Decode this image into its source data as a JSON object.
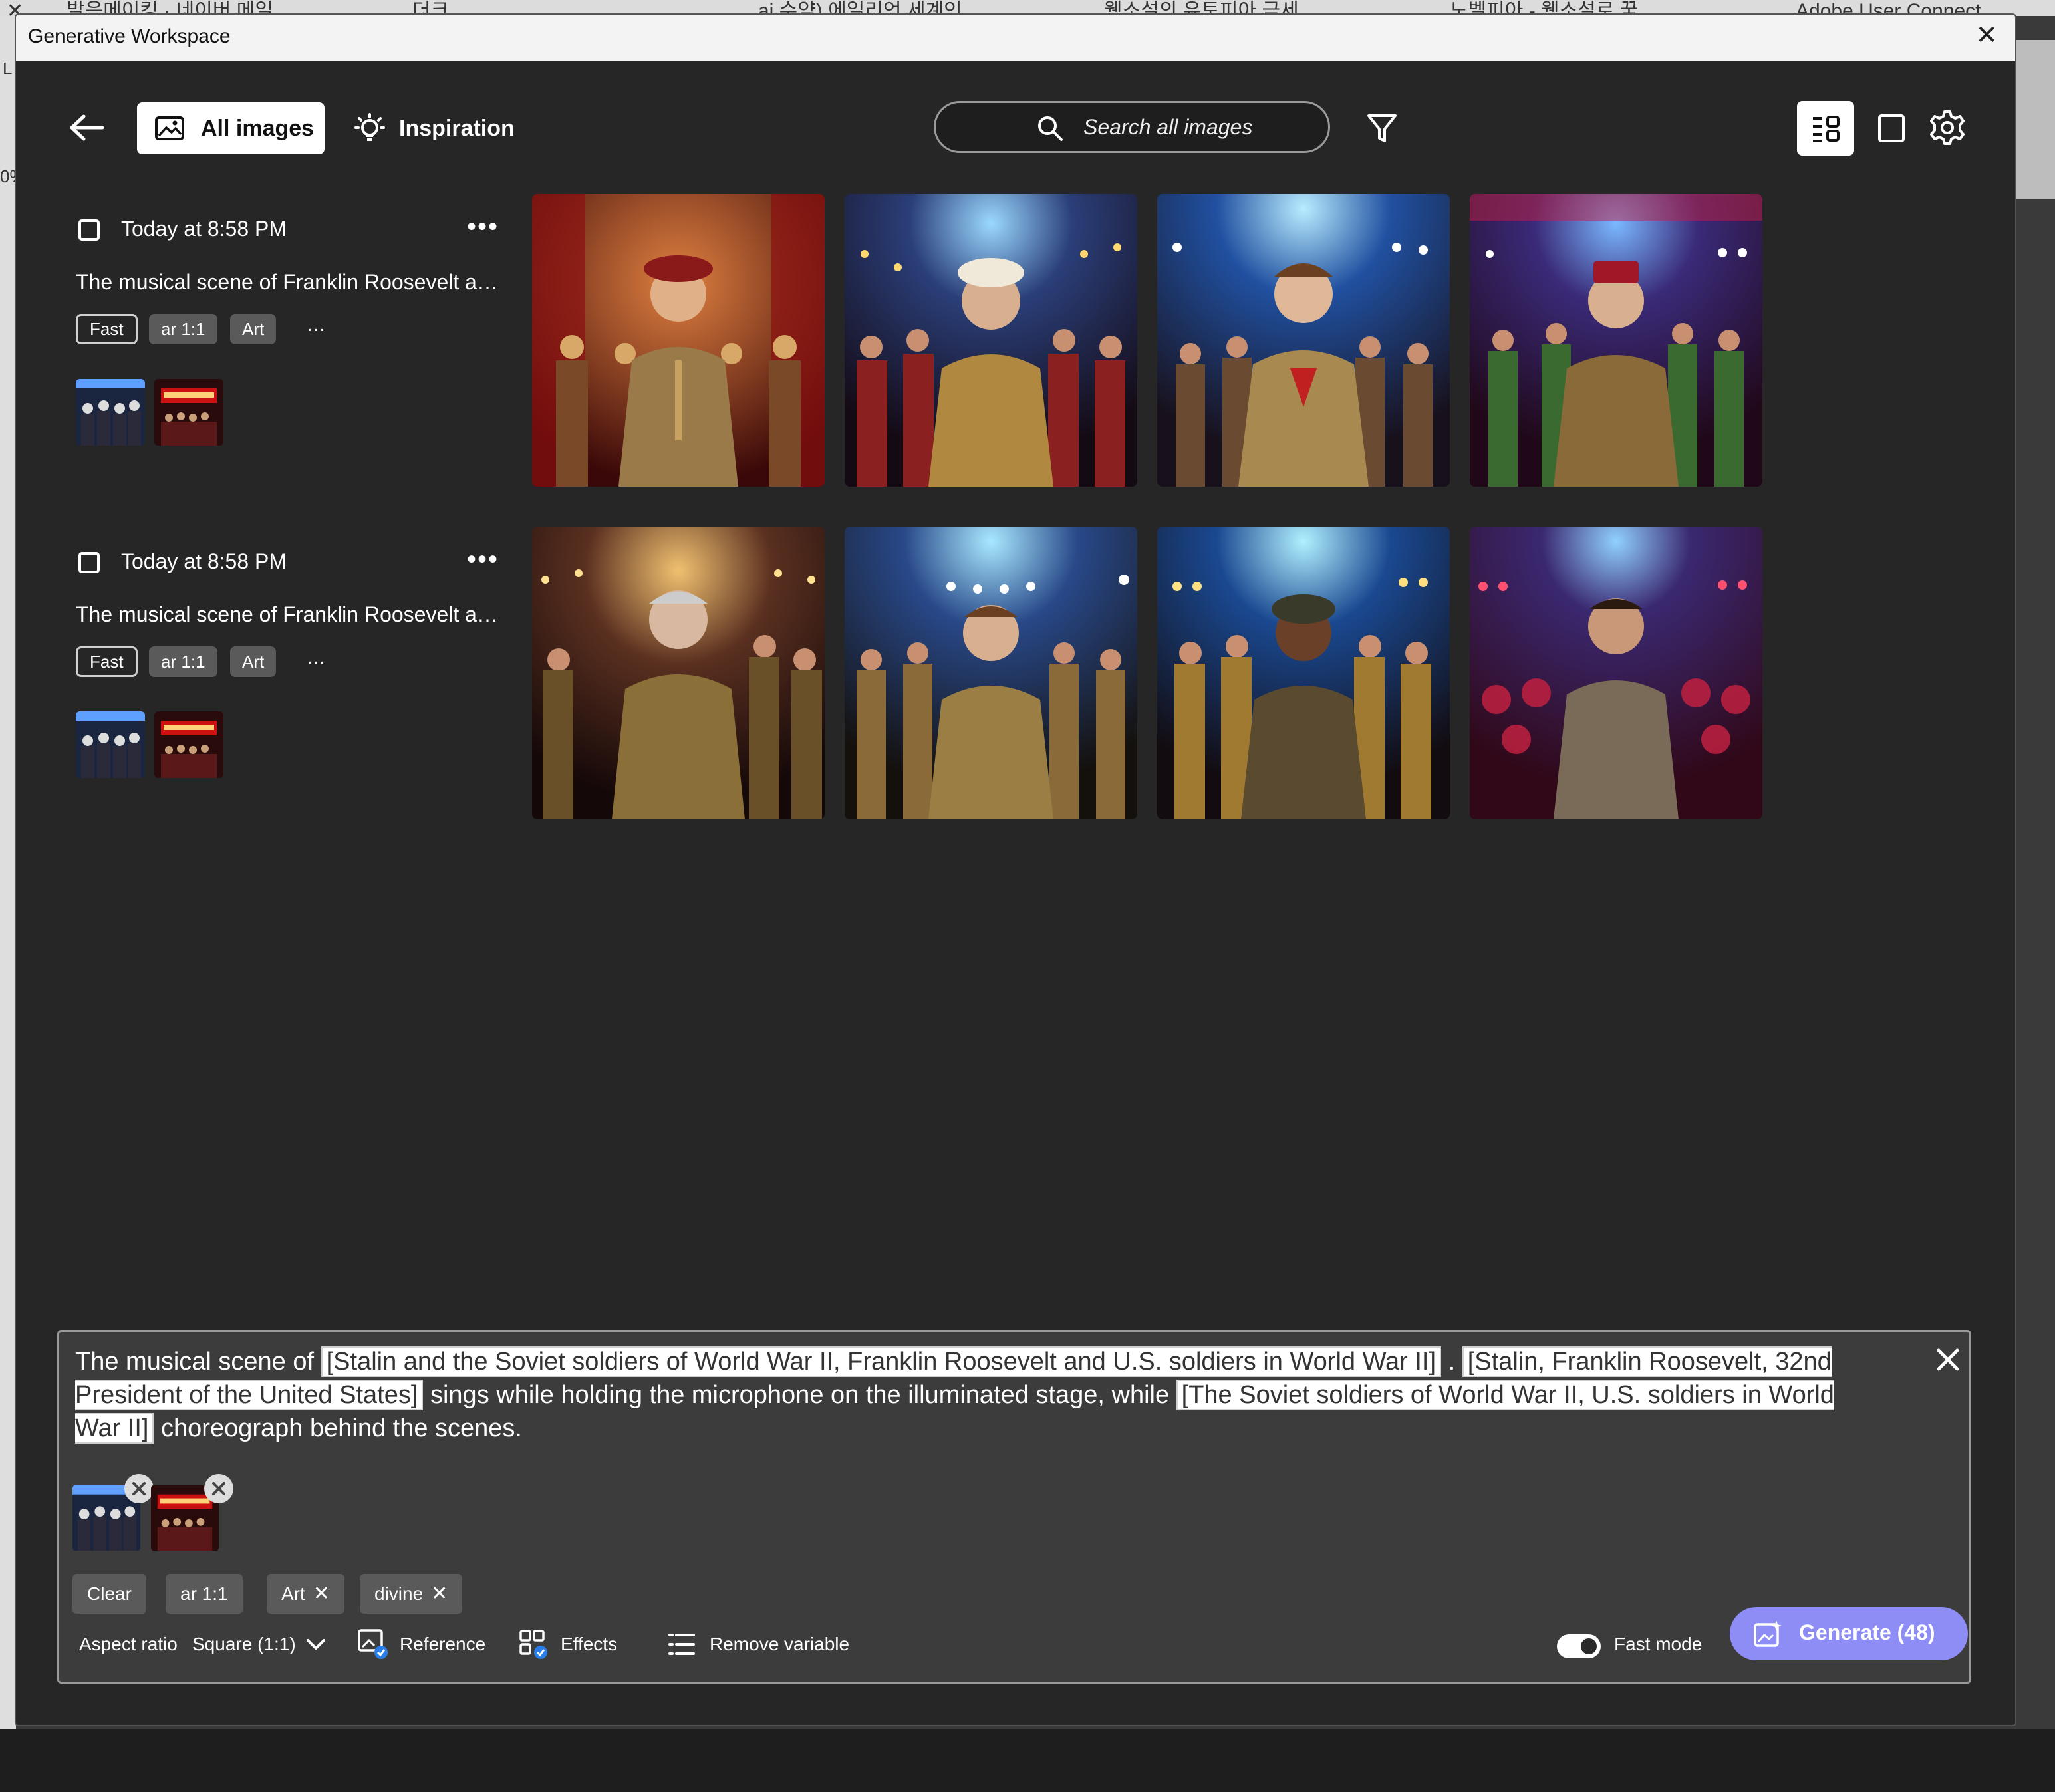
{
  "browser": {
    "tabs": [
      "발음메이킹 · 네이버 메일",
      "더크",
      "ai 수약) 에일리언 세계인",
      "웹소설의 유토피아 금세",
      "노벨피아 - 웹소설로 꿈",
      "Adobe User Connect"
    ],
    "left_strip": [
      "L",
      "0%"
    ]
  },
  "window": {
    "title": "Generative Workspace"
  },
  "toolbar": {
    "all_images_label": "All images",
    "inspiration_label": "Inspiration",
    "search_placeholder": "Search all images"
  },
  "history": [
    {
      "timestamp": "Today at 8:58 PM",
      "prompt": "The musical scene of Franklin Roosevelt a…",
      "tags": [
        "Fast",
        "ar 1:1",
        "Art"
      ],
      "more": "…",
      "references": [
        "soldiers-crowd",
        "chicago-poster"
      ]
    },
    {
      "timestamp": "Today at 8:58 PM",
      "prompt": "The musical scene of Franklin Roosevelt a…",
      "tags": [
        "Fast",
        "ar 1:1",
        "Art"
      ],
      "more": "…",
      "references": [
        "soldiers-crowd",
        "chicago-poster"
      ]
    }
  ],
  "prompt_panel": {
    "segments": [
      {
        "text": "The musical scene of ",
        "variable": false
      },
      {
        "text": "[Stalin and the Soviet soldiers of World War II, Franklin Roosevelt and U.S. soldiers in World War II]",
        "variable": true
      },
      {
        "text": " . ",
        "variable": false
      },
      {
        "text": "[Stalin, Franklin Roosevelt, 32nd President of the United States]",
        "variable": true
      },
      {
        "text": " sings while holding the microphone on the illuminated stage, while ",
        "variable": false
      },
      {
        "text": "[The Soviet soldiers of World War II, U.S. soldiers in World War II]",
        "variable": true
      },
      {
        "text": " choreograph behind the scenes.",
        "variable": false
      }
    ],
    "chips": {
      "clear": "Clear",
      "aspect": "ar 1:1",
      "art": "Art",
      "divine": "divine",
      "remove_glyph": "✕"
    },
    "aspect_ratio_label": "Aspect ratio",
    "aspect_ratio_value": "Square (1:1)",
    "reference_label": "Reference",
    "effects_label": "Effects",
    "remove_variable_label": "Remove variable",
    "fast_mode_label": "Fast mode",
    "fast_mode_on": true,
    "generate_label": "Generate (48)"
  },
  "colors": {
    "window_bg": "#262626",
    "panel_bg": "#3c3c3c",
    "generate_accent": "#8d8df5"
  }
}
